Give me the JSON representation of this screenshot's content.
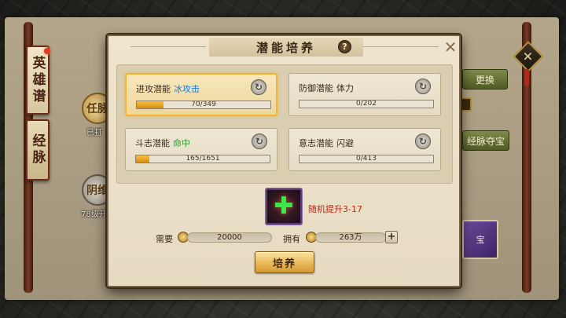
{
  "background": {
    "side_tabs": [
      "英雄谱",
      "经脉"
    ],
    "medals": [
      "任脉",
      "阴维"
    ],
    "captions": [
      "已打",
      "78级开"
    ],
    "buttons": [
      "更换",
      "经脉夺宝"
    ],
    "book_label": "宝"
  },
  "dialog": {
    "title": "潜能培养",
    "help_icon": "question-mark-icon",
    "close_icon": "close-x-icon"
  },
  "potentials": [
    {
      "label": "进攻潜能",
      "attribute": "冰攻击",
      "attribute_color": "#1a7ad6",
      "current": 70,
      "max": 349,
      "progress_text": "70/349",
      "selected": true
    },
    {
      "label": "防御潜能",
      "attribute": "体力",
      "attribute_color": "#3b2a1a",
      "current": 0,
      "max": 202,
      "progress_text": "0/202",
      "selected": false
    },
    {
      "label": "斗志潜能",
      "attribute": "命中",
      "attribute_color": "#2a9a2a",
      "current": 165,
      "max": 1651,
      "progress_text": "165/1651",
      "selected": false
    },
    {
      "label": "意志潜能",
      "attribute": "闪避",
      "attribute_color": "#3b2a1a",
      "current": 0,
      "max": 413,
      "progress_text": "0/413",
      "selected": false
    }
  ],
  "item": {
    "icon": "green-plus-stone-icon",
    "description": "随机提升3-17"
  },
  "cost": {
    "need_label": "需要",
    "need_value": "20000",
    "own_label": "拥有",
    "own_value": "263万"
  },
  "actions": {
    "add_label": "+",
    "cultivate_label": "培养"
  },
  "colors": {
    "bar_fill": "#e8a62a",
    "selected_border": "#f0b535",
    "description_red": "#c0281a"
  }
}
